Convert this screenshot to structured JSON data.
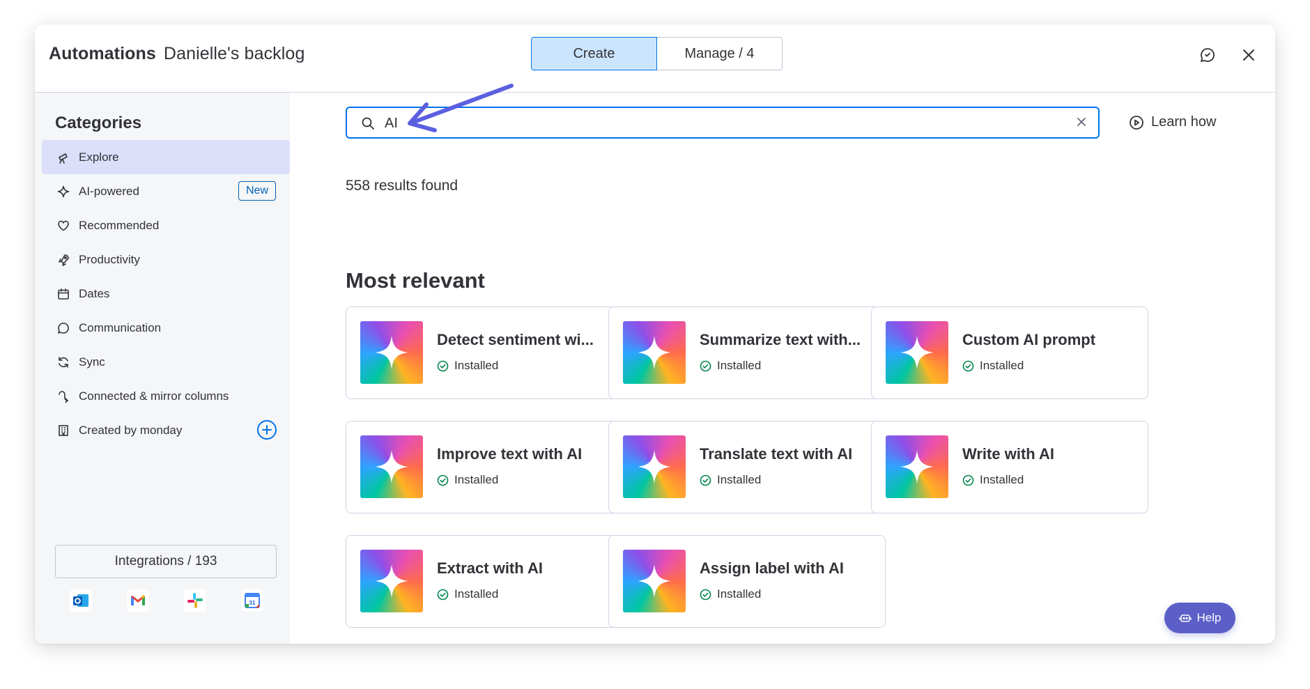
{
  "header": {
    "title_bold": "Automations",
    "title_sub": "Danielle's backlog",
    "tabs": [
      {
        "label": "Create",
        "active": true
      },
      {
        "label": "Manage / 4",
        "active": false
      }
    ],
    "icons": [
      "feedback-icon",
      "close-icon"
    ]
  },
  "sidebar": {
    "title": "Categories",
    "items": [
      {
        "label": "Explore",
        "icon": "telescope-icon",
        "active": true
      },
      {
        "label": "AI-powered",
        "icon": "sparkle-icon",
        "badge": "New"
      },
      {
        "label": "Recommended",
        "icon": "heart-icon"
      },
      {
        "label": "Productivity",
        "icon": "rocket-icon"
      },
      {
        "label": "Dates",
        "icon": "calendar-icon"
      },
      {
        "label": "Communication",
        "icon": "chat-icon"
      },
      {
        "label": "Sync",
        "icon": "sync-icon"
      },
      {
        "label": "Connected & mirror columns",
        "icon": "mirror-icon"
      },
      {
        "label": "Created by monday",
        "icon": "building-icon"
      }
    ],
    "integrations_label": "Integrations / 193",
    "integration_icons": [
      "outlook-icon",
      "gmail-icon",
      "slack-icon",
      "google-calendar-icon"
    ]
  },
  "search": {
    "value": "AI"
  },
  "learn_how": "Learn how",
  "results_text": "558 results found",
  "section_title": "Most relevant",
  "cards": [
    {
      "name": "Detect sentiment wi...",
      "status": "Installed"
    },
    {
      "name": "Summarize text with...",
      "status": "Installed"
    },
    {
      "name": "Custom AI prompt",
      "status": "Installed"
    },
    {
      "name": "Improve text with AI",
      "status": "Installed"
    },
    {
      "name": "Translate text with AI",
      "status": "Installed"
    },
    {
      "name": "Write with AI",
      "status": "Installed"
    },
    {
      "name": "Extract with AI",
      "status": "Installed"
    },
    {
      "name": "Assign label with AI",
      "status": "Installed"
    }
  ],
  "help_label": "Help",
  "colors": {
    "accent": "#0073ea",
    "active_tab_bg": "#cce5ff",
    "sidebar_bg": "#f5f6f8",
    "sidebar_active": "#dcdff9",
    "help_bg": "#5b5fc7",
    "installed": "#00854d",
    "arrow": "#5b5fe0"
  }
}
